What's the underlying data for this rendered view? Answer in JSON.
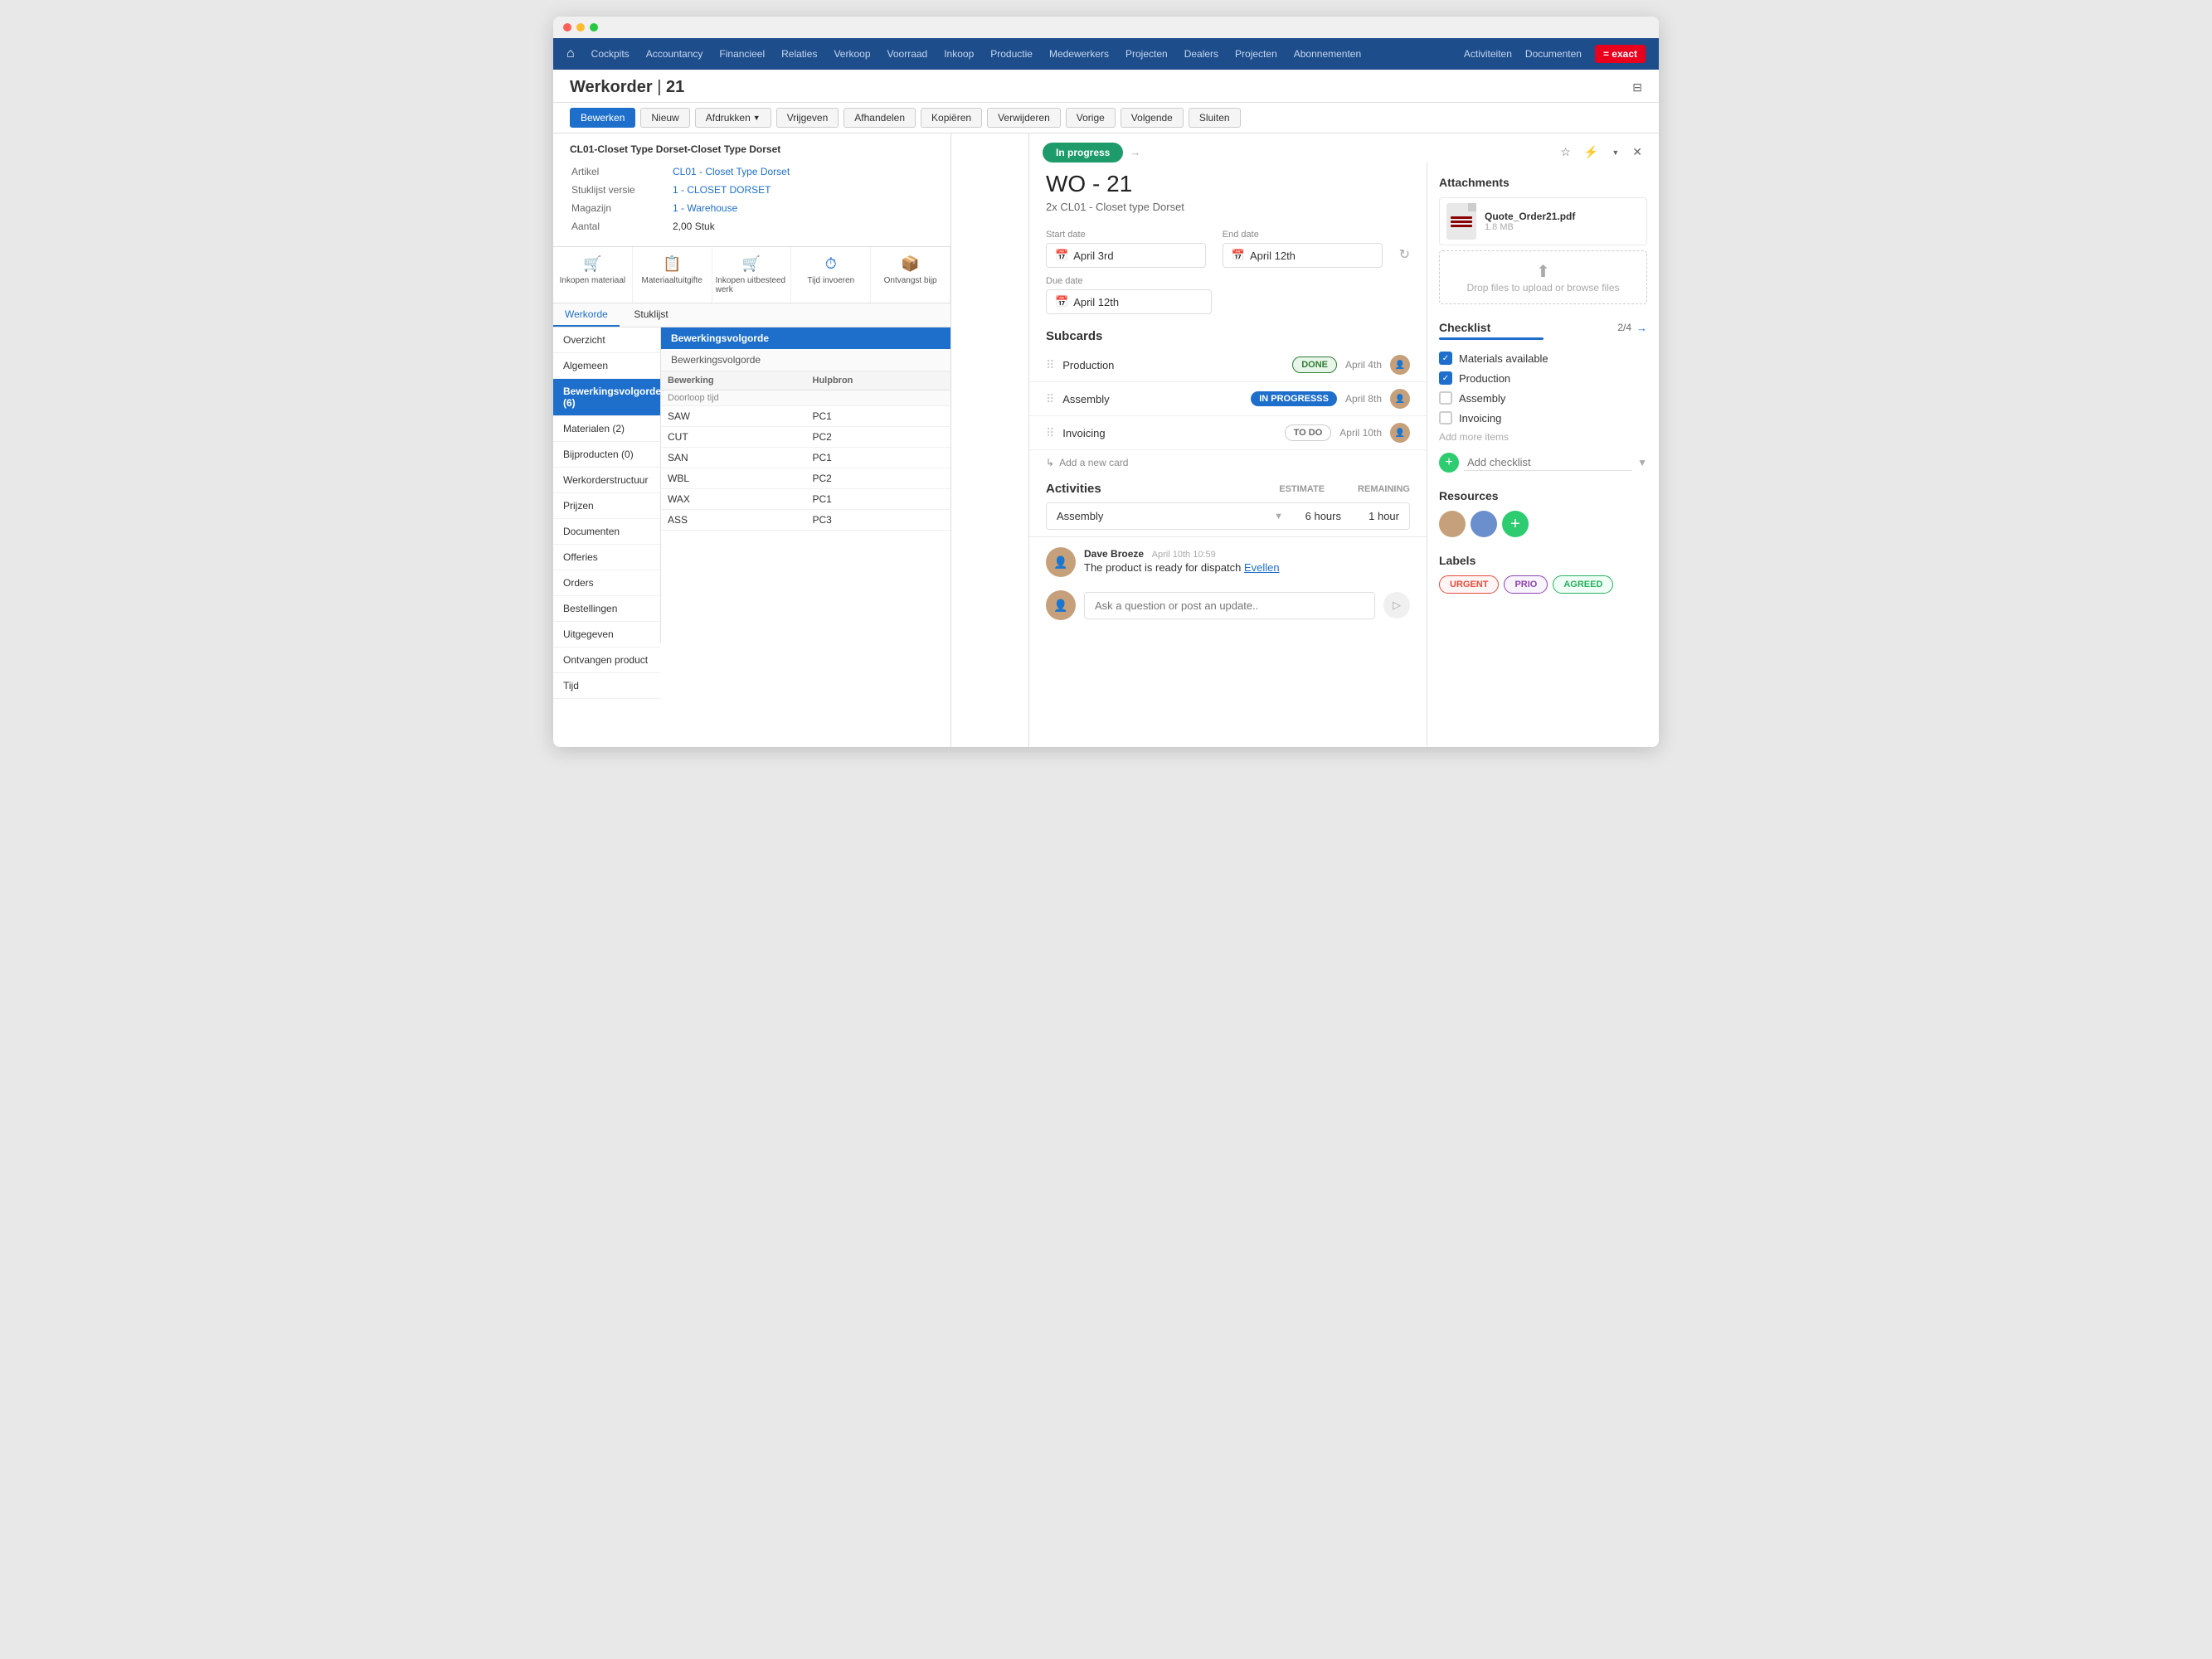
{
  "window": {
    "title": "Werkorder 21"
  },
  "nav": {
    "home": "🏠",
    "items": [
      "Cockpits",
      "Accountancy",
      "Financieel",
      "Relaties",
      "Verkoop",
      "Voorraad",
      "Inkoop",
      "Productie",
      "Medewerkers",
      "Projecten",
      "Dealers",
      "Projecten",
      "Abonnementen"
    ],
    "right_items": [
      "Activiteiten",
      "Documenten"
    ],
    "brand": "= exact"
  },
  "page": {
    "title_prefix": "Werkorder",
    "title_number": "21"
  },
  "toolbar": {
    "buttons": [
      "Bewerken",
      "Nieuw",
      "Afdrukken",
      "Vrijgeven",
      "Afhandelen",
      "Kopiëren",
      "Verwijderen",
      "Vorige",
      "Volgende",
      "Sluiten"
    ]
  },
  "info_card": {
    "title": "CL01-Closet Type Dorset-Closet Type Dorset",
    "fields": [
      {
        "label": "Artikel",
        "value": "CL01 - Closet Type Dorset",
        "link": true
      },
      {
        "label": "Stuklijst versie",
        "value": "1 - CLOSET DORSET",
        "link": true
      },
      {
        "label": "Magazijn",
        "value": "1 - Warehouse",
        "link": true
      },
      {
        "label": "Aantal",
        "value": "2,00 Stuk",
        "link": false
      }
    ]
  },
  "action_icons": [
    {
      "icon": "🛒",
      "label": "Inkopen materiaal"
    },
    {
      "icon": "📋",
      "label": "Materiaaltuitgifte"
    },
    {
      "icon": "🛒",
      "label": "Inkopen uitbesteed werk"
    },
    {
      "icon": "⏱",
      "label": "Tijd invoeren"
    },
    {
      "icon": "📦",
      "label": "Ontvangst bijp"
    }
  ],
  "left_menu": [
    {
      "label": "Overzicht",
      "active": false
    },
    {
      "label": "Algemeen",
      "active": false
    },
    {
      "label": "Bewerkingsvolgorde (6)",
      "active": true
    },
    {
      "label": "Materialen (2)",
      "active": false
    },
    {
      "label": "Bijproducten (0)",
      "active": false
    },
    {
      "label": "Werkorderstructuur",
      "active": false
    },
    {
      "label": "Prijzen",
      "active": false
    },
    {
      "label": "Documenten",
      "active": false
    },
    {
      "label": "Offeries",
      "active": false
    },
    {
      "label": "Orders",
      "active": false
    },
    {
      "label": "Bestellingen",
      "active": false
    },
    {
      "label": "Uitgegeven",
      "active": false
    },
    {
      "label": "Ontvangen product",
      "active": false
    },
    {
      "label": "Tijd",
      "active": false
    }
  ],
  "bewerkingsvolgorde": {
    "section_title": "Bewerkingsvolgorde",
    "sub_title": "Bewerkingsvolgorde",
    "col1": "Bewerking",
    "col2": "Hulpbron",
    "col3": "Doorloop tijd",
    "rows": [
      {
        "bewerking": "SAW",
        "hulpbron": "PC1"
      },
      {
        "bewerking": "CUT",
        "hulpbron": "PC2"
      },
      {
        "bewerking": "SAN",
        "hulpbron": "PC1"
      },
      {
        "bewerking": "WBL",
        "hulpbron": "PC2"
      },
      {
        "bewerking": "WAX",
        "hulpbron": "PC1"
      },
      {
        "bewerking": "ASS",
        "hulpbron": "PC3"
      }
    ]
  },
  "remarks_tabs": [
    "Werkorde",
    "Stuklijst"
  ],
  "overlay": {
    "status": "In progress",
    "wo_number": "WO - 21",
    "subtitle": "2x CL01 - Closet type Dorset",
    "start_date_label": "Start date",
    "start_date": "April 3rd",
    "end_date_label": "End date",
    "end_date": "April 12th",
    "due_date_label": "Due date",
    "due_date": "April 12th",
    "subcards_title": "Subcards",
    "subcards": [
      {
        "name": "Production",
        "status": "DONE",
        "status_type": "done",
        "date": "April 4th"
      },
      {
        "name": "Assembly",
        "status": "IN PROGRESSS",
        "status_type": "inprogress",
        "date": "April 8th"
      },
      {
        "name": "Invoicing",
        "status": "TO DO",
        "status_type": "todo",
        "date": "April 10th"
      }
    ],
    "add_card_label": "Add a new card",
    "activities_title": "Activities",
    "estimate_label": "ESTIMATE",
    "remaining_label": "REMAINING",
    "activity_row": {
      "name": "Assembly",
      "estimate": "6 hours",
      "remaining": "1 hour"
    },
    "comment": {
      "author": "Dave Broeze",
      "date": "April 10th 10:59",
      "text": "The product is ready for dispatch",
      "link": "Evellen"
    },
    "comment_placeholder": "Ask a question or post an update.."
  },
  "sidebar": {
    "attachments_title": "Attachments",
    "attachment": {
      "name": "Quote_Order21.pdf",
      "size": "1.8 MB"
    },
    "drop_zone": "Drop files to upload\nor browse files",
    "checklist_title": "Checklist",
    "checklist_count": "2/4",
    "checklist_items": [
      {
        "label": "Materials available",
        "checked": true
      },
      {
        "label": "Production",
        "checked": true
      },
      {
        "label": "Assembly",
        "checked": false
      },
      {
        "label": "Invoicing",
        "checked": false
      }
    ],
    "add_checklist_placeholder": "Add checklist",
    "add_more_label": "Add more items",
    "resources_title": "Resources",
    "labels_title": "Labels",
    "labels": [
      {
        "text": "URGENT",
        "type": "urgent"
      },
      {
        "text": "PRIO",
        "type": "prio"
      },
      {
        "text": "AGREED",
        "type": "agreed"
      }
    ]
  }
}
